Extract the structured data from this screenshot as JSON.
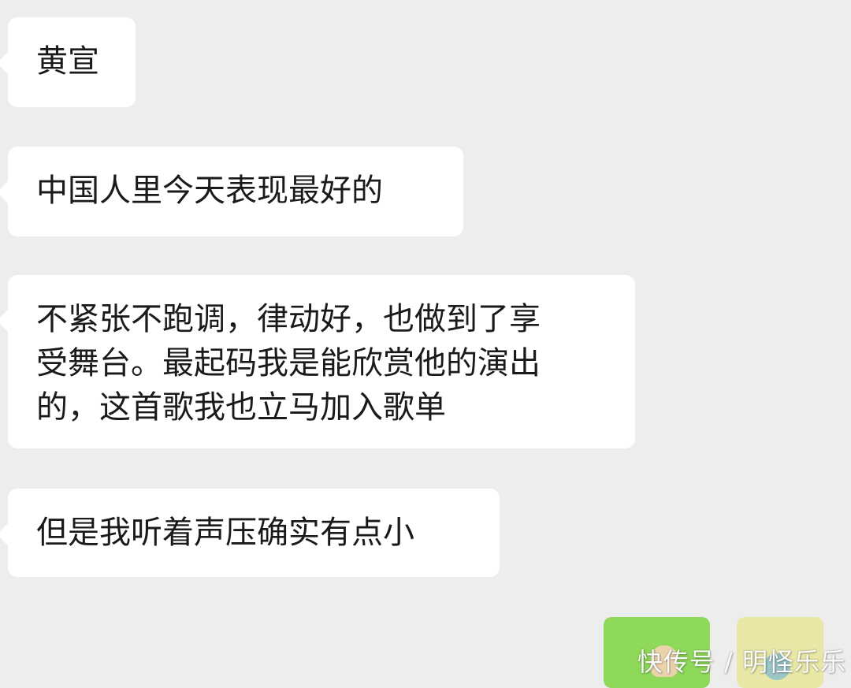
{
  "messages": [
    {
      "text": "黄宣"
    },
    {
      "text": "中国人里今天表现最好的"
    },
    {
      "lines": [
        "不紧张不跑调，律动好，也做到了享",
        "受舞台。最起码我是能欣赏他的演出",
        "的，这首歌我也立马加入歌单"
      ]
    },
    {
      "text": "但是我听着声压确实有点小"
    }
  ],
  "stickers": [
    {
      "icon": "hand-gesture-sticker",
      "color": "#8ed85a"
    },
    {
      "icon": "cartoon-sticker",
      "color": "#e8e7a6"
    }
  ],
  "watermark": {
    "text": "快传号 / 明怪乐乐"
  }
}
